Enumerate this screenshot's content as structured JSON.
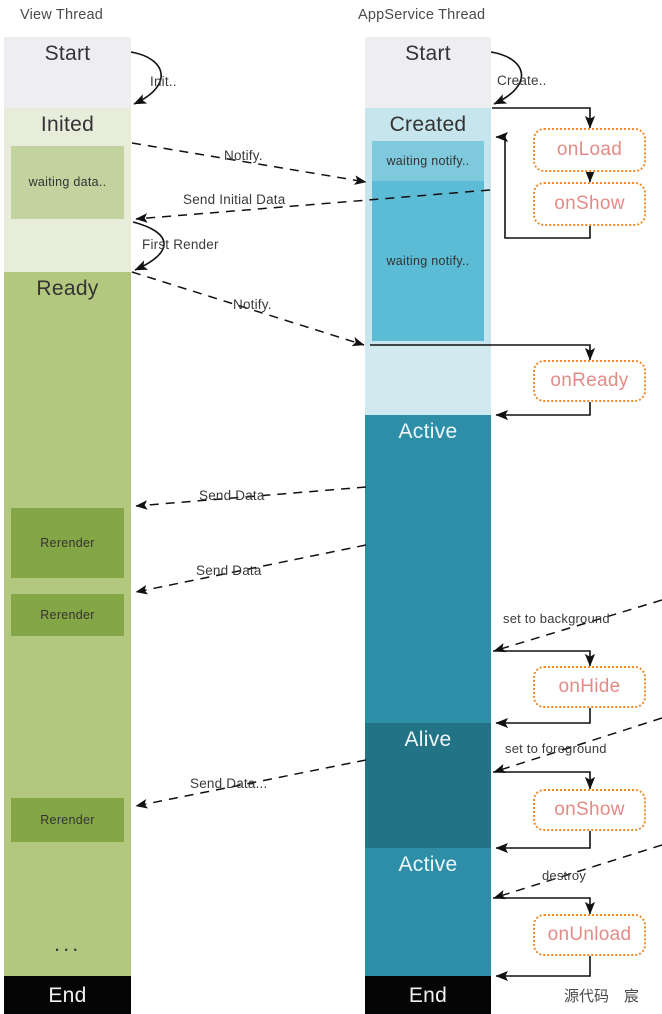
{
  "diagram": {
    "title": "Mini Program Page Lifecycle",
    "watermark": "源代码　宸",
    "colors": {
      "start_gray": "#eeedf2",
      "inited_light_green": "#e7ecdb",
      "waiting_green": "#c3d3a0",
      "ready_green": "#b2c87e",
      "rerender_green": "#84a646",
      "created_light_blue": "#c7e5ec",
      "waiting_notify_blue_light": "#7ec9dc",
      "waiting_notify_blue": "#5cbcd6",
      "onready_band": "#d2e9ef",
      "active_blue": "#2e8ea8",
      "alive_blue": "#237387",
      "end_black": "#050505",
      "hook_border": "#ee8b2e",
      "hook_text": "#e38b86",
      "arrow": "#111111"
    },
    "columns": [
      {
        "id": "view-thread",
        "header": "View Thread",
        "blocks": [
          {
            "label": "Start",
            "kind": "state"
          },
          {
            "label": "Inited",
            "kind": "state"
          },
          {
            "label": "waiting data..",
            "kind": "sub"
          },
          {
            "label": "",
            "kind": "gap"
          },
          {
            "label": "Ready",
            "kind": "state"
          },
          {
            "label": "Rerender",
            "kind": "sub"
          },
          {
            "label": "Rerender",
            "kind": "sub"
          },
          {
            "label": "Rerender",
            "kind": "sub"
          },
          {
            "label": "...",
            "kind": "ellipsis"
          },
          {
            "label": "End",
            "kind": "end"
          }
        ]
      },
      {
        "id": "appservice-thread",
        "header": "AppService Thread",
        "blocks": [
          {
            "label": "Start",
            "kind": "state"
          },
          {
            "label": "Created",
            "kind": "state"
          },
          {
            "label": "waiting notify..",
            "kind": "sub"
          },
          {
            "label": "waiting notify..",
            "kind": "sub"
          },
          {
            "label": "",
            "kind": "gap"
          },
          {
            "label": "Active",
            "kind": "state"
          },
          {
            "label": "Alive",
            "kind": "state"
          },
          {
            "label": "Active",
            "kind": "state"
          },
          {
            "label": "End",
            "kind": "end"
          }
        ]
      }
    ],
    "hooks": [
      {
        "label": "onLoad"
      },
      {
        "label": "onShow"
      },
      {
        "label": "onReady"
      },
      {
        "label": "onHide"
      },
      {
        "label": "onShow"
      },
      {
        "label": "onUnload"
      }
    ],
    "edges": [
      {
        "label": "Init..",
        "style": "solid"
      },
      {
        "label": "Create..",
        "style": "solid"
      },
      {
        "label": "Notify.",
        "style": "dashed"
      },
      {
        "label": "Send Initial Data",
        "style": "dashed"
      },
      {
        "label": "First Render",
        "style": "solid"
      },
      {
        "label": "Notify.",
        "style": "dashed"
      },
      {
        "label": "Send Data",
        "style": "dashed"
      },
      {
        "label": "Send Data",
        "style": "dashed"
      },
      {
        "label": "set to background",
        "style": "dashed"
      },
      {
        "label": "set to foreground",
        "style": "dashed"
      },
      {
        "label": "Send Data...",
        "style": "dashed"
      },
      {
        "label": "destroy",
        "style": "dashed"
      }
    ]
  }
}
